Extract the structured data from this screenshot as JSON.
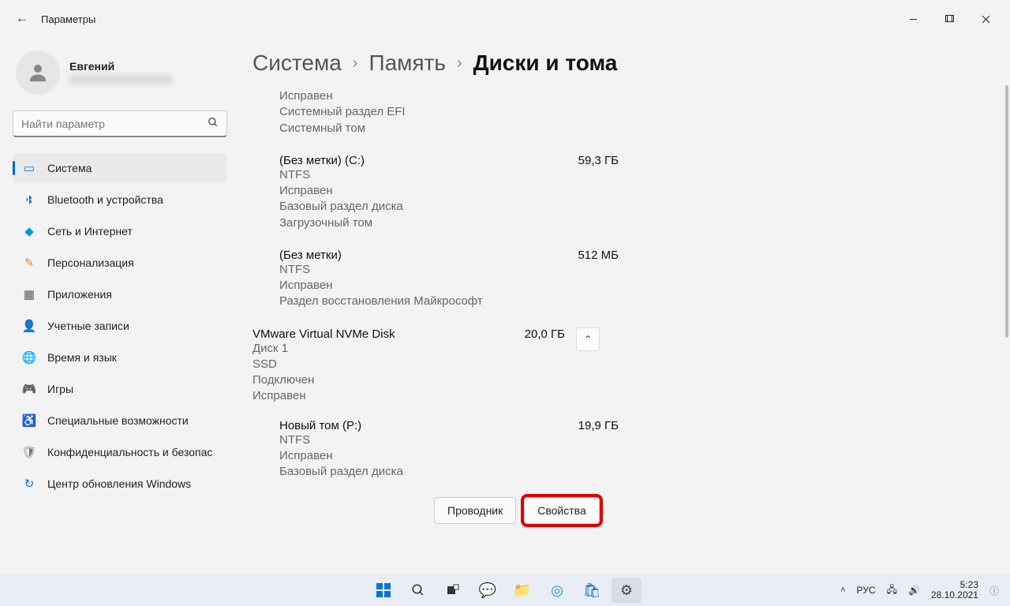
{
  "titlebar": {
    "title": "Параметры"
  },
  "user": {
    "name": "Евгений"
  },
  "search": {
    "placeholder": "Найти параметр"
  },
  "nav": {
    "system": "Система",
    "bluetooth": "Bluetooth и устройства",
    "network": "Сеть и Интернет",
    "personalization": "Персонализация",
    "apps": "Приложения",
    "accounts": "Учетные записи",
    "time": "Время и язык",
    "gaming": "Игры",
    "accessibility": "Специальные возможности",
    "privacy": "Конфиденциальность и безопас",
    "update": "Центр обновления Windows"
  },
  "breadcrumb": {
    "c1": "Система",
    "c2": "Память",
    "c3": "Диски и тома"
  },
  "vol_efi_partial": {
    "l1": "Исправен",
    "l2": "Системный раздел EFI",
    "l3": "Системный том"
  },
  "vol_c": {
    "title": "(Без метки) (C:)",
    "size": "59,3 ГБ",
    "l1": "NTFS",
    "l2": "Исправен",
    "l3": "Базовый раздел диска",
    "l4": "Загрузочный том"
  },
  "vol_rec": {
    "title": "(Без метки)",
    "size": "512 МБ",
    "l1": "NTFS",
    "l2": "Исправен",
    "l3": "Раздел восстановления Майкрософт"
  },
  "disk1": {
    "title": "VMware Virtual NVMe Disk",
    "size": "20,0 ГБ",
    "l1": "Диск 1",
    "l2": "SSD",
    "l3": "Подключен",
    "l4": "Исправен"
  },
  "vol_p": {
    "title": "Новый том (P:)",
    "size": "19,9 ГБ",
    "l1": "NTFS",
    "l2": "Исправен",
    "l3": "Базовый раздел диска"
  },
  "buttons": {
    "explorer": "Проводник",
    "properties": "Свойства"
  },
  "tray": {
    "lang": "РУС",
    "time": "5:23",
    "date": "28.10.2021"
  }
}
